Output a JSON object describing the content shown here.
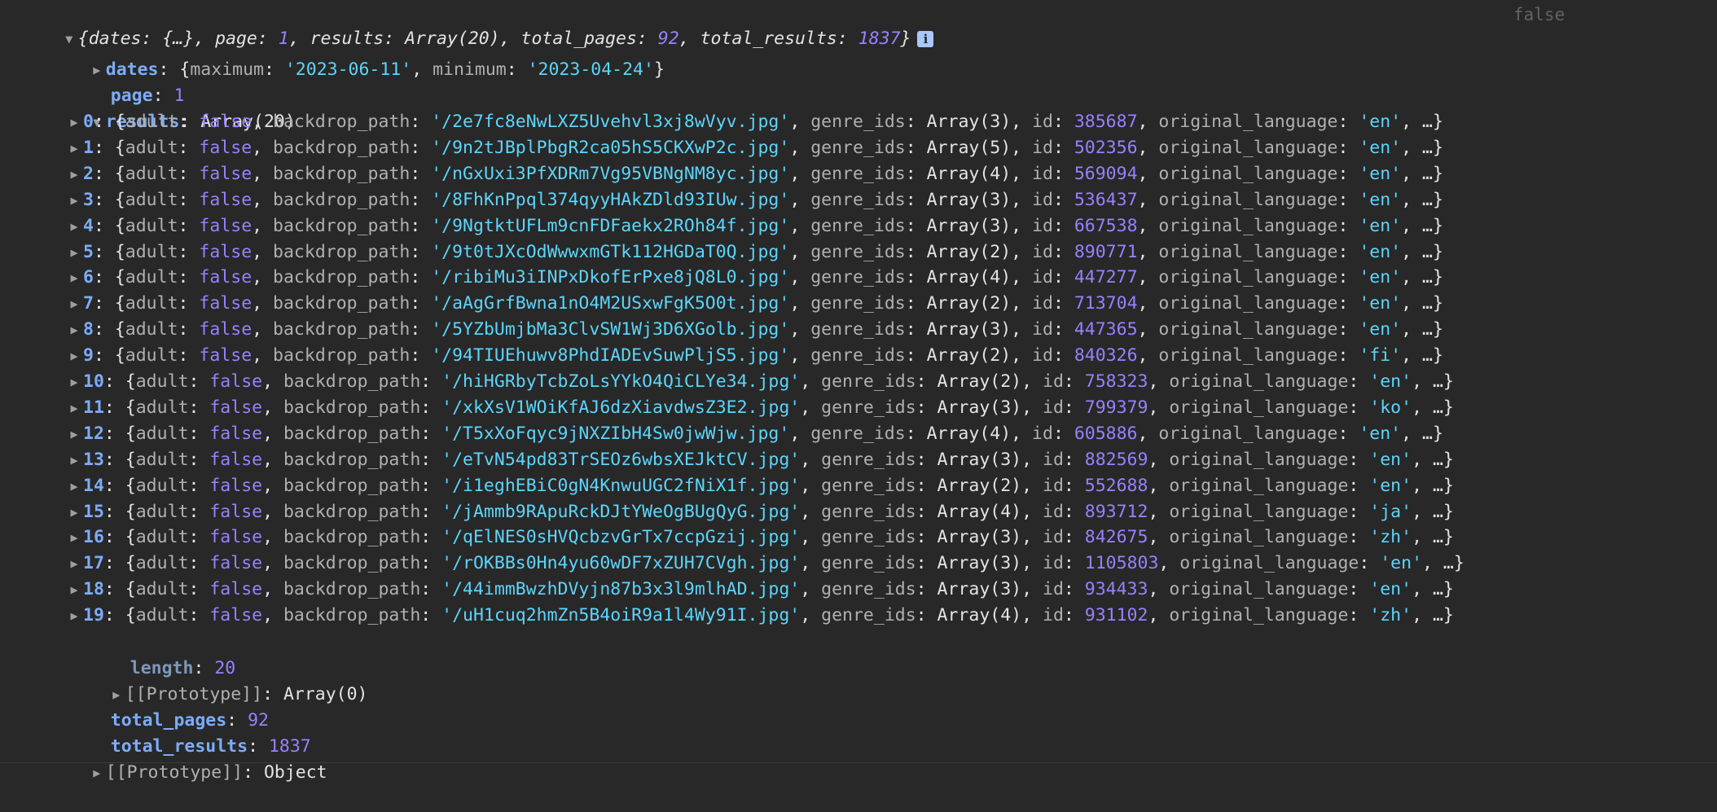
{
  "summary": {
    "dates_key": "dates",
    "dates_val": "{…}",
    "page_key": "page",
    "page_val": "1",
    "results_key": "results",
    "results_val": "Array(20)",
    "total_pages_key": "total_pages",
    "total_pages_val": "92",
    "total_results_key": "total_results",
    "total_results_val": "1837"
  },
  "right_badge": "false",
  "dates": {
    "key": "dates",
    "maximum_key": "maximum",
    "maximum_val": "'2023-06-11'",
    "minimum_key": "minimum",
    "minimum_val": "'2023-04-24'"
  },
  "page": {
    "key": "page",
    "value": "1"
  },
  "results": {
    "key": "results",
    "type": "Array(20)",
    "items": [
      {
        "index": "0",
        "adult": "false",
        "backdrop_path": "'/2e7fc8eNwLXZ5Uvehvl3xj8wVyv.jpg'",
        "genre_ids": "Array(3)",
        "id": "385687",
        "original_language": "'en'"
      },
      {
        "index": "1",
        "adult": "false",
        "backdrop_path": "'/9n2tJBplPbgR2ca05hS5CKXwP2c.jpg'",
        "genre_ids": "Array(5)",
        "id": "502356",
        "original_language": "'en'"
      },
      {
        "index": "2",
        "adult": "false",
        "backdrop_path": "'/nGxUxi3PfXDRm7Vg95VBNgNM8yc.jpg'",
        "genre_ids": "Array(4)",
        "id": "569094",
        "original_language": "'en'"
      },
      {
        "index": "3",
        "adult": "false",
        "backdrop_path": "'/8FhKnPpql374qyyHAkZDld93IUw.jpg'",
        "genre_ids": "Array(3)",
        "id": "536437",
        "original_language": "'en'"
      },
      {
        "index": "4",
        "adult": "false",
        "backdrop_path": "'/9NgtktUFLm9cnFDFaekx2ROh84f.jpg'",
        "genre_ids": "Array(3)",
        "id": "667538",
        "original_language": "'en'"
      },
      {
        "index": "5",
        "adult": "false",
        "backdrop_path": "'/9t0tJXcOdWwwxmGTk112HGDaT0Q.jpg'",
        "genre_ids": "Array(2)",
        "id": "890771",
        "original_language": "'en'"
      },
      {
        "index": "6",
        "adult": "false",
        "backdrop_path": "'/ribiMu3iINPxDkofErPxe8jQ8L0.jpg'",
        "genre_ids": "Array(4)",
        "id": "447277",
        "original_language": "'en'"
      },
      {
        "index": "7",
        "adult": "false",
        "backdrop_path": "'/aAgGrfBwna1nO4M2USxwFgK5O0t.jpg'",
        "genre_ids": "Array(2)",
        "id": "713704",
        "original_language": "'en'"
      },
      {
        "index": "8",
        "adult": "false",
        "backdrop_path": "'/5YZbUmjbMa3ClvSW1Wj3D6XGolb.jpg'",
        "genre_ids": "Array(3)",
        "id": "447365",
        "original_language": "'en'"
      },
      {
        "index": "9",
        "adult": "false",
        "backdrop_path": "'/94TIUEhuwv8PhdIADEvSuwPljS5.jpg'",
        "genre_ids": "Array(2)",
        "id": "840326",
        "original_language": "'fi'"
      },
      {
        "index": "10",
        "adult": "false",
        "backdrop_path": "'/hiHGRbyTcbZoLsYYkO4QiCLYe34.jpg'",
        "genre_ids": "Array(2)",
        "id": "758323",
        "original_language": "'en'"
      },
      {
        "index": "11",
        "adult": "false",
        "backdrop_path": "'/xkXsV1WOiKfAJ6dzXiavdwsZ3E2.jpg'",
        "genre_ids": "Array(3)",
        "id": "799379",
        "original_language": "'ko'"
      },
      {
        "index": "12",
        "adult": "false",
        "backdrop_path": "'/T5xXoFqyc9jNXZIbH4Sw0jwWjw.jpg'",
        "genre_ids": "Array(4)",
        "id": "605886",
        "original_language": "'en'"
      },
      {
        "index": "13",
        "adult": "false",
        "backdrop_path": "'/eTvN54pd83TrSEOz6wbsXEJktCV.jpg'",
        "genre_ids": "Array(3)",
        "id": "882569",
        "original_language": "'en'"
      },
      {
        "index": "14",
        "adult": "false",
        "backdrop_path": "'/i1eghEBiC0gN4KnwuUGC2fNiX1f.jpg'",
        "genre_ids": "Array(2)",
        "id": "552688",
        "original_language": "'en'"
      },
      {
        "index": "15",
        "adult": "false",
        "backdrop_path": "'/jAmmb9RApuRckDJtYWeOgBUgQyG.jpg'",
        "genre_ids": "Array(4)",
        "id": "893712",
        "original_language": "'ja'"
      },
      {
        "index": "16",
        "adult": "false",
        "backdrop_path": "'/qElNES0sHVQcbzvGrTx7ccpGzij.jpg'",
        "genre_ids": "Array(3)",
        "id": "842675",
        "original_language": "'zh'"
      },
      {
        "index": "17",
        "adult": "false",
        "backdrop_path": "'/rOKBBs0Hn4yu60wDF7xZUH7CVgh.jpg'",
        "genre_ids": "Array(3)",
        "id": "1105803",
        "original_language": "'en'"
      },
      {
        "index": "18",
        "adult": "false",
        "backdrop_path": "'/44immBwzhDVyjn87b3x3l9mlhAD.jpg'",
        "genre_ids": "Array(3)",
        "id": "934433",
        "original_language": "'en'"
      },
      {
        "index": "19",
        "adult": "false",
        "backdrop_path": "'/uH1cuq2hmZn5B4oiR9a1l4Wy91I.jpg'",
        "genre_ids": "Array(4)",
        "id": "931102",
        "original_language": "'zh'"
      }
    ],
    "length_key": "length",
    "length_val": "20",
    "prototype_key": "[[Prototype]]",
    "prototype_val": "Array(0)"
  },
  "total_pages": {
    "key": "total_pages",
    "value": "92"
  },
  "total_results": {
    "key": "total_results",
    "value": "1837"
  },
  "prototype": {
    "key": "[[Prototype]]",
    "value": "Object"
  },
  "labels": {
    "adult": "adult",
    "backdrop_path": "backdrop_path",
    "genre_ids": "genre_ids",
    "id": "id",
    "original_language": "original_language",
    "ellipsis": "…"
  },
  "icons": {
    "expanded": "triangle-down-icon",
    "collapsed": "triangle-right-icon",
    "info": "info-icon"
  },
  "colors": {
    "background": "#282828",
    "key": "#7cacf8",
    "string": "#5cd5fb",
    "number": "#9980ff",
    "text": "#e3e3e3"
  }
}
